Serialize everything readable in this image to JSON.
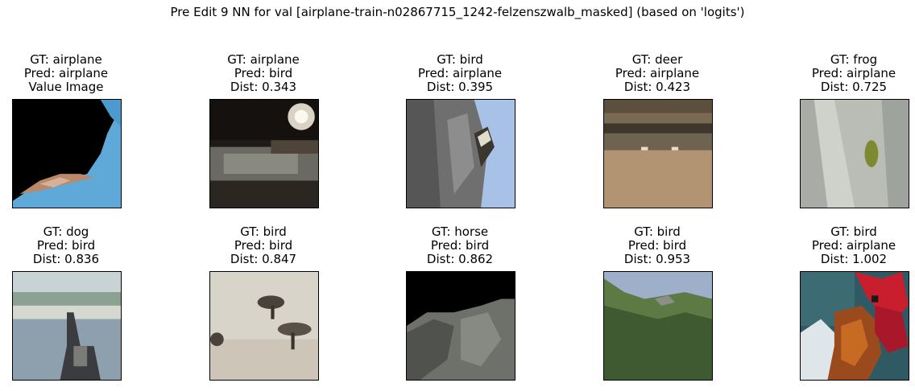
{
  "title": "Pre Edit 9 NN for val [airplane-train-n02867715_1242-felzenszwalb_masked] (based on 'logits')",
  "panels": [
    {
      "gt": "GT: airplane",
      "pred": "Pred: airplane",
      "third": "Value Image",
      "image": "masked-airplane-sky"
    },
    {
      "gt": "GT: airplane",
      "pred": "Pred: bird",
      "third": "Dist: 0.343",
      "image": "night-street-light"
    },
    {
      "gt": "GT: bird",
      "pred": "Pred: airplane",
      "third": "Dist: 0.395",
      "image": "bird-on-tree-trunk"
    },
    {
      "gt": "GT: deer",
      "pred": "Pred: airplane",
      "third": "Dist: 0.423",
      "image": "deer-in-field"
    },
    {
      "gt": "GT: frog",
      "pred": "Pred: airplane",
      "third": "Dist: 0.725",
      "image": "frog-on-white-surface"
    },
    {
      "gt": "GT: dog",
      "pred": "Pred: bird",
      "third": "Dist: 0.836",
      "image": "dog-on-beach"
    },
    {
      "gt": "GT: bird",
      "pred": "Pred: bird",
      "third": "Dist: 0.847",
      "image": "birds-on-sand"
    },
    {
      "gt": "GT: horse",
      "pred": "Pred: bird",
      "third": "Dist: 0.862",
      "image": "masked-horse"
    },
    {
      "gt": "GT: bird",
      "pred": "Pred: bird",
      "third": "Dist: 0.953",
      "image": "bird-in-trees"
    },
    {
      "gt": "GT: bird",
      "pred": "Pred: airplane",
      "third": "Dist: 1.002",
      "image": "rooster-head"
    }
  ]
}
